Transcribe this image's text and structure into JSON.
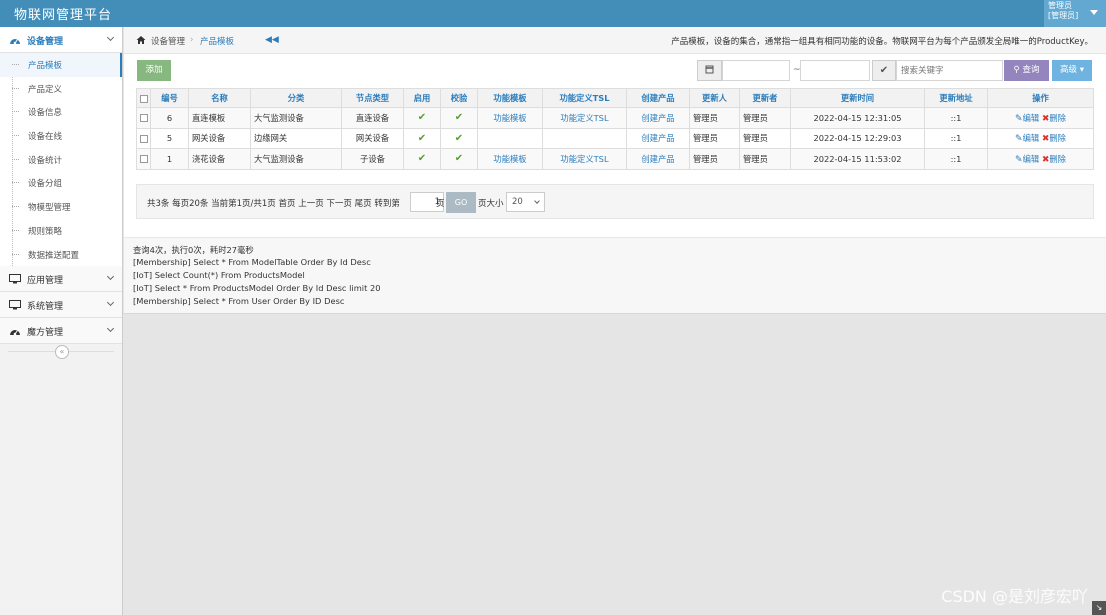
{
  "app": {
    "title": "物联网管理平台"
  },
  "user": {
    "line1": "管理员",
    "line2": "[管理员]"
  },
  "sidebar": {
    "groups": [
      {
        "label": "设备管理",
        "icon": "dashboard-icon"
      },
      {
        "label": "应用管理",
        "icon": "desktop-icon"
      },
      {
        "label": "系统管理",
        "icon": "desktop-icon"
      },
      {
        "label": "魔方管理",
        "icon": "dashboard-icon"
      }
    ],
    "items": [
      "产品模板",
      "产品定义",
      "设备信息",
      "设备在线",
      "设备统计",
      "设备分组",
      "物模型管理",
      "规则策略",
      "数据推送配置"
    ]
  },
  "breadcrumb": {
    "level1": "设备管理",
    "separator": "›",
    "level2": "产品模板",
    "back": "◀◀"
  },
  "page_description": "产品模板，设备的集合，通常指一组具有相同功能的设备。物联网平台为每个产品颁发全局唯一的ProductKey。",
  "toolbar": {
    "add_label": "添加",
    "date_separator": "~",
    "search_placeholder": "搜索关键字",
    "search_label": "查询",
    "advanced_label": "高级"
  },
  "table": {
    "columns": [
      "编号",
      "名称",
      "分类",
      "节点类型",
      "启用",
      "校验",
      "功能模板",
      "功能定义TSL",
      "创建产品",
      "更新人",
      "更新者",
      "更新时间",
      "更新地址",
      "操作"
    ],
    "rows": [
      {
        "id": "6",
        "name": "直连模板",
        "category": "大气监测设备",
        "node_type": "直连设备",
        "enabled": "✔",
        "verified": "✔",
        "func_template": "功能模板",
        "tsl": "功能定义TSL",
        "create": "创建产品",
        "updater": "管理员",
        "updater2": "管理员",
        "time": "2022-04-15 12:31:05",
        "ip": "::1",
        "edit": "编辑",
        "delete": "删除"
      },
      {
        "id": "5",
        "name": "网关设备",
        "category": "边缘网关",
        "node_type": "网关设备",
        "enabled": "✔",
        "verified": "✔",
        "func_template": "",
        "tsl": "",
        "create": "创建产品",
        "updater": "管理员",
        "updater2": "管理员",
        "time": "2022-04-15 12:29:03",
        "ip": "::1",
        "edit": "编辑",
        "delete": "删除"
      },
      {
        "id": "1",
        "name": "浇花设备",
        "category": "大气监测设备",
        "node_type": "子设备",
        "enabled": "✔",
        "verified": "✔",
        "func_template": "功能模板",
        "tsl": "功能定义TSL",
        "create": "创建产品",
        "updater": "管理员",
        "updater2": "管理员",
        "time": "2022-04-15 11:53:02",
        "ip": "::1",
        "edit": "编辑",
        "delete": "删除"
      }
    ]
  },
  "pager": {
    "summary": "共3条  每页20条  当前第1页/共1页  首页  上一页  下一页  尾页  转到第",
    "page_value": "1",
    "page_unit": "页",
    "go_label": "GO",
    "size_label": "页大小",
    "size_value": "20"
  },
  "log": {
    "lines": [
      "查询4次，执行0次，耗时27毫秒",
      "[Membership] Select * From ModelTable Order By Id Desc",
      "[IoT] Select Count(*) From ProductsModel",
      "[IoT] Select * From ProductsModel Order By Id Desc limit 20",
      "[Membership] Select * From User Order By ID Desc"
    ]
  },
  "watermark": "CSDN @是刘彦宏吖",
  "colors": {
    "navbar": "#438eb9",
    "accent": "#2b7dbc",
    "add": "#87b87f",
    "search": "#9585bf",
    "advanced": "#6fb3e0",
    "check": "#5a9e31",
    "delete": "#dd3333"
  }
}
